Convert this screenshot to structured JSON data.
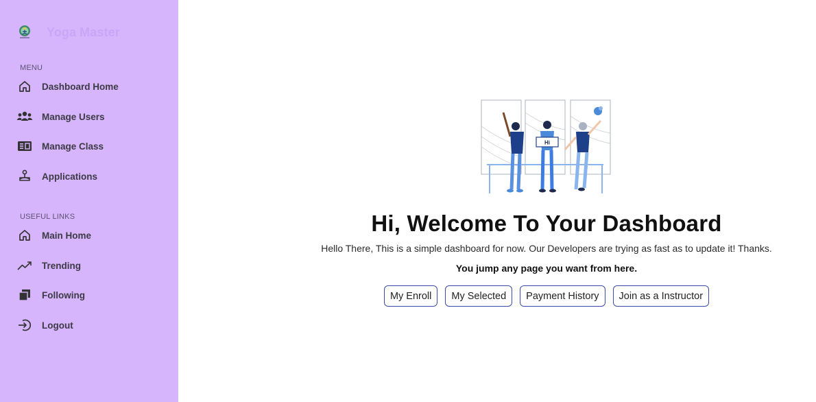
{
  "brand": {
    "name": "Yoga Master",
    "logo_icon": "yoga-logo-icon"
  },
  "sidebar": {
    "menu_label": "MENU",
    "menu_items": [
      {
        "label": "Dashboard Home",
        "icon": "home-icon"
      },
      {
        "label": "Manage Users",
        "icon": "users-icon"
      },
      {
        "label": "Manage Class",
        "icon": "class-board-icon"
      },
      {
        "label": "Applications",
        "icon": "joystick-icon"
      }
    ],
    "links_label": "USEFUL LINKS",
    "link_items": [
      {
        "label": "Main Home",
        "icon": "home-icon"
      },
      {
        "label": "Trending",
        "icon": "trending-icon"
      },
      {
        "label": "Following",
        "icon": "stack-icon"
      },
      {
        "label": "Logout",
        "icon": "logout-icon"
      }
    ]
  },
  "main": {
    "title": "Hi, Welcome To Your Dashboard",
    "subtitle": "Hello There, This is a simple dashboard for now. Our Developers are trying as fast as to update it! Thanks.",
    "hint": "You jump any page you want from here.",
    "illustration_sign": "Hi",
    "buttons": [
      {
        "label": "My Enroll"
      },
      {
        "label": "My Selected"
      },
      {
        "label": "Payment History"
      },
      {
        "label": "Join as a Instructor"
      }
    ]
  },
  "colors": {
    "sidebar_bg": "#d6b5fd",
    "button_border": "#3a4aa8",
    "brand_text": "#c9a6f7"
  }
}
